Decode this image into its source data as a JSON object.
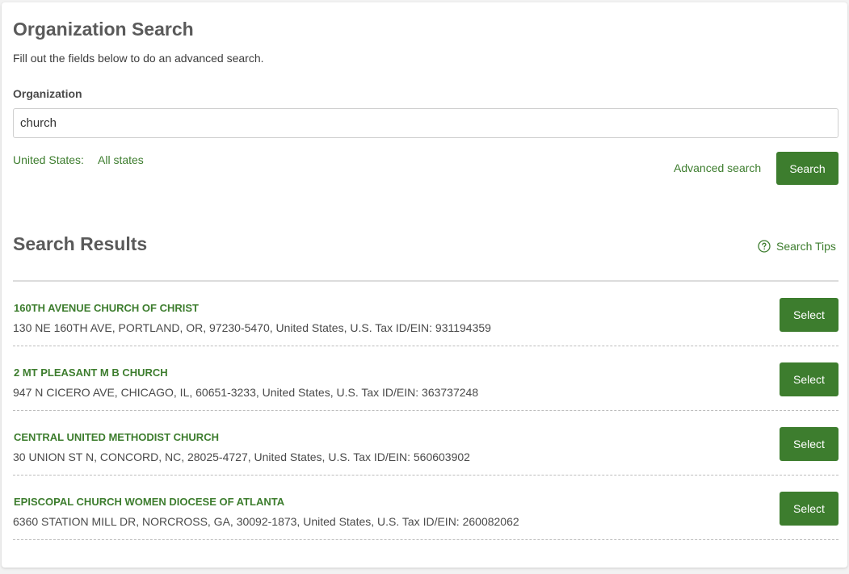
{
  "header": {
    "title": "Organization Search",
    "subtitle": "Fill out the fields below to do an advanced search."
  },
  "form": {
    "org_label": "Organization",
    "org_value": "church",
    "country_label": "United States:",
    "states_link": "All states",
    "advanced_link": "Advanced search",
    "search_button": "Search"
  },
  "results": {
    "title": "Search Results",
    "tips_label": "Search Tips",
    "tips_icon": "question-circle-icon",
    "select_label": "Select",
    "items": [
      {
        "name": "160TH AVENUE CHURCH OF CHRIST",
        "details": "130 NE 160TH AVE, PORTLAND, OR, 97230-5470, United States, U.S. Tax ID/EIN: 931194359"
      },
      {
        "name": "2 MT PLEASANT M B CHURCH",
        "details": "947 N CICERO AVE, CHICAGO, IL, 60651-3233, United States, U.S. Tax ID/EIN: 363737248"
      },
      {
        "name": "CENTRAL UNITED METHODIST CHURCH",
        "details": "30 UNION ST N, CONCORD, NC, 28025-4727, United States, U.S. Tax ID/EIN: 560603902"
      },
      {
        "name": "EPISCOPAL CHURCH WOMEN DIOCESE OF ATLANTA",
        "details": "6360 STATION MILL DR, NORCROSS, GA, 30092-1873, United States, U.S. Tax ID/EIN: 260082062"
      }
    ]
  },
  "colors": {
    "accent": "#3d7d2e",
    "heading": "#5a5a5a",
    "text": "#4a4a4a"
  }
}
